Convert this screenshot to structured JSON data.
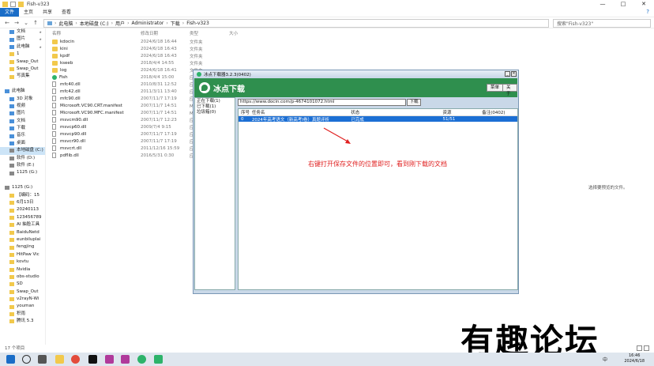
{
  "window": {
    "title": "Fish-v323",
    "controls": [
      "—",
      "□",
      "✕"
    ]
  },
  "ribbon": {
    "tabs": [
      "文件",
      "主页",
      "共享",
      "查看"
    ],
    "help_icon": "?"
  },
  "address": {
    "parts": [
      "此电脑",
      "本地磁盘 (C:)",
      "用户",
      "Administrator",
      "下载",
      "Fish-v323"
    ],
    "search_placeholder": "搜索\"Fish-v323\""
  },
  "sidebar": {
    "items": [
      {
        "label": "文档",
        "icon": "document-icon",
        "pinned": true
      },
      {
        "label": "图片",
        "icon": "picture-icon",
        "pinned": true
      },
      {
        "label": "此电脑",
        "icon": "computer-icon",
        "pinned": true
      },
      {
        "label": "1",
        "icon": "folder-icon"
      },
      {
        "label": "Swap_Out",
        "icon": "folder-icon"
      },
      {
        "label": "Swap_Out",
        "icon": "folder-icon"
      },
      {
        "label": "写真集",
        "icon": "folder-icon"
      },
      {
        "label": "",
        "icon": ""
      },
      {
        "label": "此电脑",
        "icon": "computer-icon",
        "level0": true
      },
      {
        "label": "3D 对象",
        "icon": "3d-objects-icon"
      },
      {
        "label": "视频",
        "icon": "video-icon"
      },
      {
        "label": "图片",
        "icon": "picture-icon"
      },
      {
        "label": "文档",
        "icon": "document-icon"
      },
      {
        "label": "下载",
        "icon": "download-icon"
      },
      {
        "label": "音乐",
        "icon": "music-icon"
      },
      {
        "label": "桌面",
        "icon": "desktop-icon"
      },
      {
        "label": "本地磁盘 (C:)",
        "icon": "drive-icon",
        "selected": true
      },
      {
        "label": "软件 (D:)",
        "icon": "drive-icon"
      },
      {
        "label": "软件 (E:)",
        "icon": "drive-icon"
      },
      {
        "label": "1125 (G:)",
        "icon": "drive-icon"
      },
      {
        "label": "",
        "icon": ""
      },
      {
        "label": "1125 (G:)",
        "icon": "drive-icon",
        "level0": true
      },
      {
        "label": "【编码：15",
        "icon": "folder-icon"
      },
      {
        "label": "6月13日",
        "icon": "folder-icon"
      },
      {
        "label": "20240113",
        "icon": "folder-icon"
      },
      {
        "label": "123456789",
        "icon": "folder-icon"
      },
      {
        "label": "AI 抽脸工具",
        "icon": "folder-icon"
      },
      {
        "label": "BaiduNetd",
        "icon": "folder-icon"
      },
      {
        "label": "eunbiluplai",
        "icon": "folder-icon"
      },
      {
        "label": "fengjing",
        "icon": "folder-icon"
      },
      {
        "label": "HitPaw Vic",
        "icon": "folder-icon"
      },
      {
        "label": "kovtu",
        "icon": "folder-icon"
      },
      {
        "label": "Nvidia",
        "icon": "folder-icon"
      },
      {
        "label": "obs-studio",
        "icon": "folder-icon"
      },
      {
        "label": "SD",
        "icon": "folder-icon"
      },
      {
        "label": "Swap_Out",
        "icon": "folder-icon"
      },
      {
        "label": "v2rayN-Wi",
        "icon": "folder-icon"
      },
      {
        "label": "youman",
        "icon": "folder-icon"
      },
      {
        "label": "积雨",
        "icon": "folder-icon"
      },
      {
        "label": "腾讯 5.3",
        "icon": "folder-icon"
      }
    ]
  },
  "filelist": {
    "headers": [
      "名称",
      "修改日期",
      "类型",
      "大小"
    ],
    "rows": [
      {
        "name": "kdocin",
        "date": "2024/6/18 16:44",
        "type": "文件夹",
        "size": "",
        "kind": "folder"
      },
      {
        "name": "kini",
        "date": "2024/6/18 16:43",
        "type": "文件夹",
        "size": "",
        "kind": "folder"
      },
      {
        "name": "kpdf",
        "date": "2024/6/18 16:43",
        "type": "文件夹",
        "size": "",
        "kind": "folder"
      },
      {
        "name": "kseeb",
        "date": "2018/4/4 14:55",
        "type": "文件夹",
        "size": "",
        "kind": "folder"
      },
      {
        "name": "log",
        "date": "2024/6/18 16:41",
        "type": "文件夹",
        "size": "",
        "kind": "folder"
      },
      {
        "name": "Fish",
        "date": "2018/4/4 15:00",
        "type": "应用程序",
        "size": "",
        "kind": "app"
      },
      {
        "name": "mfc40.dll",
        "date": "2010/8/31 12:52",
        "type": "应用程序扩展",
        "size": "",
        "kind": "dll"
      },
      {
        "name": "mfc42.dll",
        "date": "2011/3/11 13:40",
        "type": "应用程序扩展",
        "size": "",
        "kind": "dll"
      },
      {
        "name": "mfc90.dll",
        "date": "2007/11/7 17:19",
        "type": "应用程序扩展",
        "size": "",
        "kind": "dll"
      },
      {
        "name": "Microsoft.VC90.CRT.manifest",
        "date": "2007/11/7 14:51",
        "type": "MANIFEST 文件",
        "size": "",
        "kind": "dll"
      },
      {
        "name": "Microsoft.VC90.MFC.manifest",
        "date": "2007/11/7 14:51",
        "type": "MANIFEST 文件",
        "size": "",
        "kind": "dll"
      },
      {
        "name": "msvcm90.dll",
        "date": "2007/11/7 12:23",
        "type": "应用程序扩展",
        "size": "",
        "kind": "dll"
      },
      {
        "name": "msvcp60.dll",
        "date": "2009/7/4 9:15",
        "type": "应用程序扩展",
        "size": "",
        "kind": "dll"
      },
      {
        "name": "msvcp90.dll",
        "date": "2007/11/7 17:19",
        "type": "应用程序扩展",
        "size": "",
        "kind": "dll"
      },
      {
        "name": "msvcr90.dll",
        "date": "2007/11/7 17:19",
        "type": "应用程序扩展",
        "size": "",
        "kind": "dll"
      },
      {
        "name": "msvcrt.dll",
        "date": "2011/12/16 15:59",
        "type": "应用程序扩展",
        "size": "",
        "kind": "dll"
      },
      {
        "name": "pdflib.dll",
        "date": "2016/5/31 0:30",
        "type": "应用程序扩展",
        "size": "",
        "kind": "dll"
      }
    ]
  },
  "preview_text": "选择要预览的文件。",
  "statusbar": {
    "count": "17 个项目"
  },
  "dialog": {
    "title": "冰点下载器3.2.3(0402)",
    "brand": "冰点下载",
    "menu_button": "菜单",
    "about_button": "关于",
    "side_items": [
      "正在下载(1)",
      "已下载(1)",
      "垃圾箱(0)"
    ],
    "url_value": "https://www.docin.com/p-4674101072.html",
    "download_button": "下载",
    "table_headers": [
      "序号",
      "任务名",
      "状态",
      "资源",
      "备注(0402)"
    ],
    "table_rows": [
      {
        "no": "0",
        "name": "2024年高考语文（新高考Ⅰ卷）真题评析",
        "status": "已完成",
        "res": "51/51",
        "note": ""
      }
    ]
  },
  "annotation": "右键打开保存文件的位置即可，看到刚下载的文档",
  "watermark": "有趣论坛",
  "taskbar": {
    "time": "16:46",
    "date": "2024/6/18",
    "ime": "中"
  },
  "colors": {
    "accent": "#1a6dc7",
    "dialog_header": "#2f8f4e",
    "selection": "#1c6fd4",
    "annotation": "#e02020"
  }
}
